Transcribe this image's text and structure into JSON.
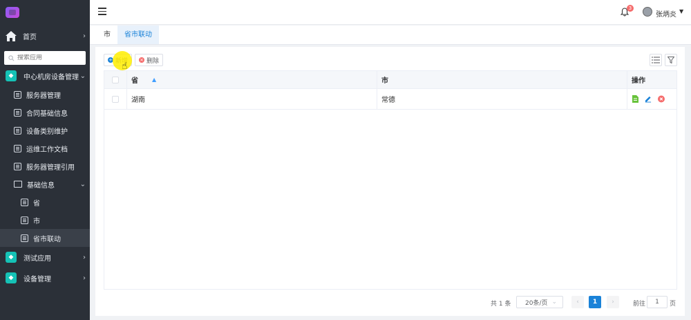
{
  "sidebar": {
    "items": [
      {
        "label": "首页"
      },
      {
        "label": "中心机房设备管理"
      },
      {
        "label": "服务器管理"
      },
      {
        "label": "合同基础信息"
      },
      {
        "label": "设备类别维护"
      },
      {
        "label": "运维工作文档"
      },
      {
        "label": "服务器管理引用"
      },
      {
        "label": "基础信息"
      },
      {
        "label": "省"
      },
      {
        "label": "市"
      },
      {
        "label": "省市联动"
      },
      {
        "label": "测试应用"
      },
      {
        "label": "设备管理"
      }
    ],
    "search_placeholder": "搜索应用"
  },
  "header": {
    "notification_count": "3",
    "username": "张炳炎"
  },
  "tabs": [
    {
      "label": "市"
    },
    {
      "label": "省市联动"
    }
  ],
  "toolbar": {
    "add_label": "新增",
    "delete_label": "删除"
  },
  "table": {
    "columns": [
      "省",
      "市",
      "操作"
    ],
    "rows": [
      {
        "province": "湖南",
        "city": "常德"
      }
    ]
  },
  "pagination": {
    "total": "共 1 条",
    "page_size": "20条/页",
    "current_page": "1",
    "goto_label": "前往",
    "goto_value": "1",
    "page_suffix": "页"
  },
  "colors": {
    "sidebar_bg": "#2b3038",
    "accent": "#1a82d8",
    "cube_icon": "#15c2b6",
    "badge": "#f56c6c"
  }
}
